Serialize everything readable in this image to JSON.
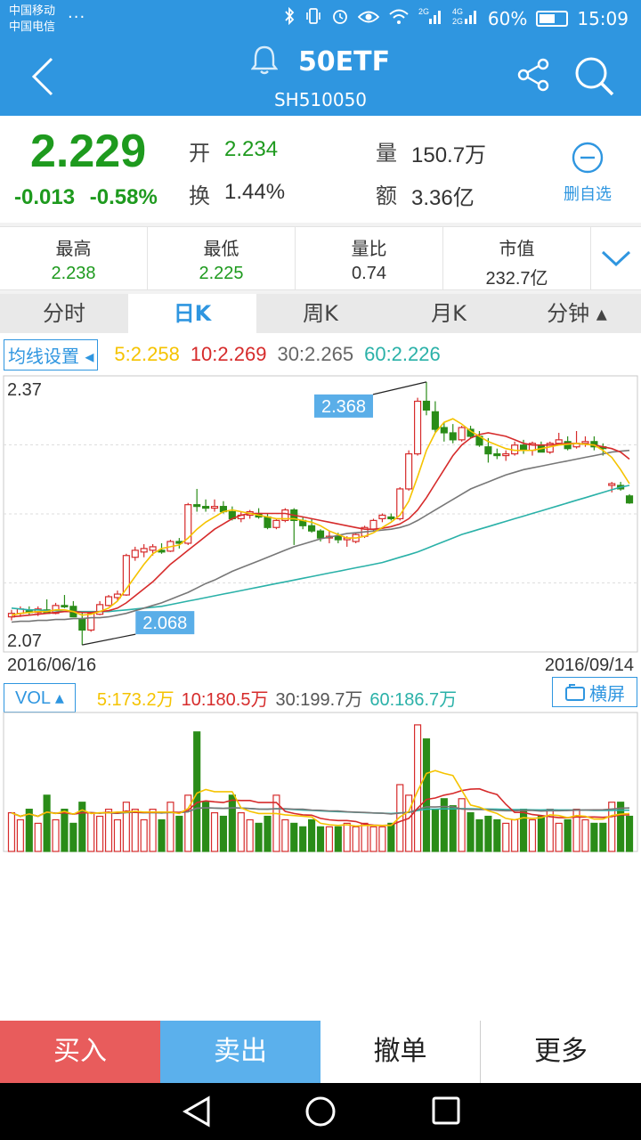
{
  "status_bar": {
    "carrier1": "中国移动",
    "carrier2": "中国电信",
    "more_dots": "...",
    "battery": "60%",
    "battery_level": 0.6,
    "time": "15:09",
    "net1": "2G",
    "net2": "4G",
    "net3": "2G"
  },
  "header": {
    "title": "50ETF",
    "code": "SH510050"
  },
  "quote": {
    "price": "2.229",
    "change": "-0.013",
    "change_pct": "-0.58%",
    "open_label": "开",
    "open_value": "2.234",
    "turnover_label": "换",
    "turnover_value": "1.44%",
    "volume_label": "量",
    "volume_value": "150.7万",
    "amount_label": "额",
    "amount_value": "3.36亿",
    "unwatch_label": "删自选"
  },
  "stats": [
    {
      "label": "最高",
      "value": "2.238",
      "color": "#1e9a1e"
    },
    {
      "label": "最低",
      "value": "2.225",
      "color": "#1e9a1e"
    },
    {
      "label": "量比",
      "value": "0.74",
      "color": "#333333"
    },
    {
      "label": "市值",
      "value": "232.7亿",
      "color": "#333333"
    }
  ],
  "tabs": [
    "分时",
    "日K",
    "周K",
    "月K",
    "分钟 ▴"
  ],
  "active_tab": 1,
  "ma": {
    "settings_label": "均线设置",
    "items": [
      {
        "label": "5:2.258",
        "color": "#f5c300"
      },
      {
        "label": "10:2.269",
        "color": "#d62b2b"
      },
      {
        "label": "30:2.265",
        "color": "#666666"
      },
      {
        "label": "60:2.226",
        "color": "#2ab1a8"
      }
    ]
  },
  "vol": {
    "label": "VOL ▴",
    "items": [
      {
        "label": "5:173.2万",
        "color": "#f5c300"
      },
      {
        "label": "10:180.5万",
        "color": "#d62b2b"
      },
      {
        "label": "30:199.7万",
        "color": "#555555"
      },
      {
        "label": "60:186.7万",
        "color": "#2ab1a8"
      }
    ],
    "landscape_label": "横屏"
  },
  "chart_data": {
    "type": "candlestick",
    "y_top_label": "2.37",
    "y_bottom_label": "2.07",
    "ylim": [
      2.06,
      2.375
    ],
    "start_date": "2016/06/16",
    "end_date": "2016/09/14",
    "max_callout": "2.368",
    "min_callout": "2.068",
    "colors": {
      "up": "#d62b2b",
      "down": "#2a8c18",
      "ma5": "#f5c300",
      "ma10": "#d62b2b",
      "ma30": "#777777",
      "ma60": "#2ab1a8"
    },
    "ohlc": [
      [
        2.1,
        2.108,
        2.096,
        2.104
      ],
      [
        2.104,
        2.112,
        2.1,
        2.109
      ],
      [
        2.107,
        2.112,
        2.102,
        2.105
      ],
      [
        2.105,
        2.112,
        2.101,
        2.109
      ],
      [
        2.108,
        2.12,
        2.104,
        2.104
      ],
      [
        2.104,
        2.116,
        2.103,
        2.113
      ],
      [
        2.113,
        2.125,
        2.11,
        2.112
      ],
      [
        2.112,
        2.118,
        2.1,
        2.1
      ],
      [
        2.098,
        2.105,
        2.068,
        2.085
      ],
      [
        2.085,
        2.106,
        2.083,
        2.104
      ],
      [
        2.103,
        2.118,
        2.102,
        2.114
      ],
      [
        2.113,
        2.125,
        2.112,
        2.123
      ],
      [
        2.122,
        2.13,
        2.119,
        2.126
      ],
      [
        2.125,
        2.172,
        2.124,
        2.17
      ],
      [
        2.168,
        2.18,
        2.164,
        2.176
      ],
      [
        2.174,
        2.183,
        2.168,
        2.178
      ],
      [
        2.176,
        2.183,
        2.17,
        2.18
      ],
      [
        2.176,
        2.184,
        2.172,
        2.174
      ],
      [
        2.175,
        2.188,
        2.174,
        2.186
      ],
      [
        2.186,
        2.19,
        2.178,
        2.184
      ],
      [
        2.184,
        2.23,
        2.182,
        2.228
      ],
      [
        2.228,
        2.246,
        2.22,
        2.226
      ],
      [
        2.226,
        2.234,
        2.22,
        2.224
      ],
      [
        2.224,
        2.234,
        2.22,
        2.226
      ],
      [
        2.226,
        2.232,
        2.218,
        2.22
      ],
      [
        2.22,
        2.226,
        2.21,
        2.212
      ],
      [
        2.212,
        2.22,
        2.208,
        2.216
      ],
      [
        2.216,
        2.222,
        2.212,
        2.22
      ],
      [
        2.218,
        2.224,
        2.212,
        2.214
      ],
      [
        2.214,
        2.218,
        2.2,
        2.202
      ],
      [
        2.202,
        2.212,
        2.2,
        2.21
      ],
      [
        2.21,
        2.224,
        2.208,
        2.222
      ],
      [
        2.222,
        2.224,
        2.182,
        2.21
      ],
      [
        2.21,
        2.214,
        2.2,
        2.204
      ],
      [
        2.204,
        2.212,
        2.196,
        2.198
      ],
      [
        2.198,
        2.2,
        2.186,
        2.19
      ],
      [
        2.19,
        2.198,
        2.184,
        2.192
      ],
      [
        2.192,
        2.196,
        2.184,
        2.188
      ],
      [
        2.188,
        2.192,
        2.18,
        2.19
      ],
      [
        2.186,
        2.196,
        2.184,
        2.194
      ],
      [
        2.192,
        2.204,
        2.19,
        2.202
      ],
      [
        2.2,
        2.212,
        2.198,
        2.21
      ],
      [
        2.212,
        2.218,
        2.208,
        2.216
      ],
      [
        2.214,
        2.218,
        2.21,
        2.212
      ],
      [
        2.212,
        2.248,
        2.21,
        2.246
      ],
      [
        2.246,
        2.29,
        2.244,
        2.286
      ],
      [
        2.286,
        2.35,
        2.284,
        2.346
      ],
      [
        2.346,
        2.368,
        2.33,
        2.336
      ],
      [
        2.334,
        2.346,
        2.31,
        2.314
      ],
      [
        2.316,
        2.322,
        2.3,
        2.31
      ],
      [
        2.31,
        2.32,
        2.298,
        2.302
      ],
      [
        2.302,
        2.318,
        2.3,
        2.316
      ],
      [
        2.314,
        2.318,
        2.304,
        2.306
      ],
      [
        2.306,
        2.312,
        2.294,
        2.296
      ],
      [
        2.294,
        2.304,
        2.276,
        2.286
      ],
      [
        2.286,
        2.292,
        2.28,
        2.284
      ],
      [
        2.284,
        2.29,
        2.278,
        2.286
      ],
      [
        2.286,
        2.3,
        2.284,
        2.296
      ],
      [
        2.296,
        2.302,
        2.286,
        2.29
      ],
      [
        2.29,
        2.3,
        2.284,
        2.298
      ],
      [
        2.296,
        2.3,
        2.288,
        2.288
      ],
      [
        2.288,
        2.3,
        2.286,
        2.298
      ],
      [
        2.298,
        2.31,
        2.296,
        2.302
      ],
      [
        2.3,
        2.306,
        2.29,
        2.292
      ],
      [
        2.294,
        2.312,
        2.292,
        2.298
      ],
      [
        2.298,
        2.306,
        2.294,
        2.3
      ],
      [
        2.3,
        2.306,
        2.29,
        2.294
      ],
      [
        2.294,
        2.298,
        2.284,
        2.292
      ],
      [
        2.25,
        2.254,
        2.242,
        2.252
      ],
      [
        2.25,
        2.254,
        2.244,
        2.246
      ],
      [
        2.238,
        2.24,
        2.229,
        2.23
      ]
    ],
    "ma5": [
      2.102,
      2.104,
      2.105,
      2.106,
      2.106,
      2.108,
      2.108,
      2.106,
      2.102,
      2.103,
      2.106,
      2.11,
      2.118,
      2.132,
      2.146,
      2.16,
      2.172,
      2.178,
      2.18,
      2.182,
      2.19,
      2.2,
      2.208,
      2.214,
      2.22,
      2.222,
      2.22,
      2.218,
      2.216,
      2.214,
      2.212,
      2.212,
      2.212,
      2.21,
      2.208,
      2.204,
      2.198,
      2.194,
      2.19,
      2.19,
      2.192,
      2.196,
      2.202,
      2.208,
      2.216,
      2.232,
      2.26,
      2.29,
      2.31,
      2.322,
      2.326,
      2.32,
      2.312,
      2.306,
      2.3,
      2.296,
      2.292,
      2.29,
      2.29,
      2.29,
      2.292,
      2.294,
      2.296,
      2.297,
      2.298,
      2.297,
      2.296,
      2.29,
      2.282,
      2.268,
      2.252
    ],
    "ma10": [
      2.1,
      2.101,
      2.102,
      2.103,
      2.104,
      2.105,
      2.106,
      2.106,
      2.105,
      2.105,
      2.106,
      2.107,
      2.11,
      2.116,
      2.124,
      2.132,
      2.14,
      2.15,
      2.16,
      2.168,
      2.176,
      2.184,
      2.192,
      2.2,
      2.206,
      2.212,
      2.216,
      2.218,
      2.218,
      2.218,
      2.218,
      2.218,
      2.216,
      2.214,
      2.212,
      2.21,
      2.208,
      2.206,
      2.204,
      2.202,
      2.2,
      2.2,
      2.201,
      2.203,
      2.206,
      2.212,
      2.222,
      2.236,
      2.252,
      2.268,
      2.284,
      2.296,
      2.304,
      2.308,
      2.31,
      2.308,
      2.306,
      2.302,
      2.298,
      2.296,
      2.296,
      2.296,
      2.297,
      2.298,
      2.298,
      2.297,
      2.296,
      2.294,
      2.292,
      2.288,
      2.28
    ],
    "ma30": [
      2.094,
      2.095,
      2.095,
      2.096,
      2.096,
      2.097,
      2.097,
      2.098,
      2.098,
      2.099,
      2.099,
      2.1,
      2.102,
      2.104,
      2.107,
      2.11,
      2.113,
      2.116,
      2.12,
      2.124,
      2.128,
      2.133,
      2.138,
      2.142,
      2.147,
      2.152,
      2.156,
      2.16,
      2.164,
      2.168,
      2.172,
      2.176,
      2.18,
      2.183,
      2.186,
      2.189,
      2.191,
      2.193,
      2.195,
      2.196,
      2.197,
      2.198,
      2.199,
      2.2,
      2.202,
      2.205,
      2.21,
      2.216,
      2.222,
      2.228,
      2.234,
      2.24,
      2.246,
      2.25,
      2.254,
      2.258,
      2.262,
      2.265,
      2.268,
      2.27,
      2.272,
      2.274,
      2.276,
      2.278,
      2.28,
      2.282,
      2.284,
      2.286,
      2.288,
      2.289,
      2.29
    ],
    "ma60": [
      2.11,
      2.109,
      2.108,
      2.108,
      2.107,
      2.107,
      2.106,
      2.106,
      2.106,
      2.106,
      2.106,
      2.106,
      2.107,
      2.108,
      2.109,
      2.11,
      2.111,
      2.112,
      2.114,
      2.116,
      2.118,
      2.12,
      2.122,
      2.124,
      2.126,
      2.128,
      2.13,
      2.132,
      2.134,
      2.136,
      2.138,
      2.14,
      2.142,
      2.144,
      2.146,
      2.148,
      2.15,
      2.152,
      2.154,
      2.156,
      2.158,
      2.16,
      2.162,
      2.165,
      2.168,
      2.171,
      2.174,
      2.178,
      2.182,
      2.186,
      2.19,
      2.194,
      2.197,
      2.2,
      2.203,
      2.206,
      2.209,
      2.212,
      2.215,
      2.218,
      2.221,
      2.224,
      2.227,
      2.23,
      2.233,
      2.236,
      2.239,
      2.242,
      2.245,
      2.248,
      2.25
    ],
    "volume": [
      55,
      45,
      60,
      40,
      80,
      45,
      60,
      40,
      70,
      55,
      50,
      60,
      45,
      70,
      60,
      45,
      60,
      45,
      70,
      50,
      80,
      170,
      70,
      55,
      50,
      80,
      55,
      45,
      40,
      50,
      80,
      45,
      40,
      35,
      45,
      35,
      35,
      35,
      40,
      35,
      40,
      35,
      35,
      40,
      95,
      80,
      180,
      160,
      60,
      75,
      65,
      75,
      55,
      45,
      50,
      45,
      40,
      45,
      60,
      45,
      50,
      60,
      40,
      45,
      60,
      45,
      40,
      40,
      70,
      70,
      50
    ]
  }
}
